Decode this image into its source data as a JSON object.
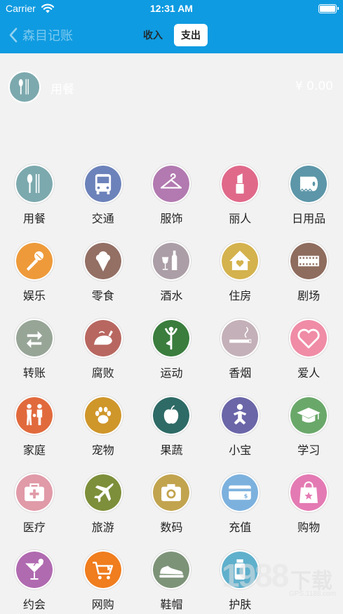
{
  "status_bar": {
    "carrier": "Carrier",
    "time": "12:31 AM"
  },
  "nav": {
    "back_label": "森目记账",
    "tabs": [
      {
        "label": "收入"
      },
      {
        "label": "支出",
        "selected": true
      }
    ]
  },
  "entry": {
    "category": "用餐",
    "amount": "¥ 0.00",
    "icon": "fork-knife-icon"
  },
  "categories": [
    {
      "label": "用餐",
      "icon": "fork-knife-icon",
      "color": "#7ca9ae"
    },
    {
      "label": "交通",
      "icon": "bus-icon",
      "color": "#6c82ba"
    },
    {
      "label": "服饰",
      "icon": "hanger-icon",
      "color": "#b27ab0"
    },
    {
      "label": "丽人",
      "icon": "lipstick-icon",
      "color": "#e0698a"
    },
    {
      "label": "日用品",
      "icon": "toilet-paper-icon",
      "color": "#5c96a8"
    },
    {
      "label": "娱乐",
      "icon": "microphone-icon",
      "color": "#ee9a3a"
    },
    {
      "label": "零食",
      "icon": "ice-cream-icon",
      "color": "#936f64"
    },
    {
      "label": "酒水",
      "icon": "wine-bottle-icon",
      "color": "#ac9ea6"
    },
    {
      "label": "住房",
      "icon": "house-heart-icon",
      "color": "#d4b24d"
    },
    {
      "label": "剧场",
      "icon": "film-strip-icon",
      "color": "#8e6c5e"
    },
    {
      "label": "转账",
      "icon": "transfer-arrows-icon",
      "color": "#97a597"
    },
    {
      "label": "腐败",
      "icon": "roast-chicken-icon",
      "color": "#b86760"
    },
    {
      "label": "运动",
      "icon": "yoga-pose-icon",
      "color": "#3a7d3d"
    },
    {
      "label": "香烟",
      "icon": "cigarette-icon",
      "color": "#c4b0b8"
    },
    {
      "label": "爱人",
      "icon": "heart-icon",
      "color": "#f08ca6"
    },
    {
      "label": "家庭",
      "icon": "family-icon",
      "color": "#e16a3d"
    },
    {
      "label": "宠物",
      "icon": "paw-icon",
      "color": "#cf962a"
    },
    {
      "label": "果蔬",
      "icon": "apple-icon",
      "color": "#2e6a66"
    },
    {
      "label": "小宝",
      "icon": "baby-icon",
      "color": "#6a66a8"
    },
    {
      "label": "学习",
      "icon": "graduation-cap-icon",
      "color": "#6aa86a"
    },
    {
      "label": "医疗",
      "icon": "medical-kit-icon",
      "color": "#e09aa8"
    },
    {
      "label": "旅游",
      "icon": "airplane-icon",
      "color": "#7d8f3a"
    },
    {
      "label": "数码",
      "icon": "camera-icon",
      "color": "#c2a44f"
    },
    {
      "label": "充值",
      "icon": "card-icon",
      "color": "#7cb1de"
    },
    {
      "label": "购物",
      "icon": "shopping-bag-icon",
      "color": "#e47ab3"
    },
    {
      "label": "约会",
      "icon": "cocktail-icon",
      "color": "#b06ab0"
    },
    {
      "label": "网购",
      "icon": "shopping-cart-icon",
      "color": "#f07d1e"
    },
    {
      "label": "鞋帽",
      "icon": "sneaker-icon",
      "color": "#7d9378"
    },
    {
      "label": "护肤",
      "icon": "skincare-bottle-icon",
      "color": "#5fb0cc"
    }
  ],
  "watermark": {
    "number": "1988",
    "text": "下载",
    "site": "GPS.1188.com"
  }
}
